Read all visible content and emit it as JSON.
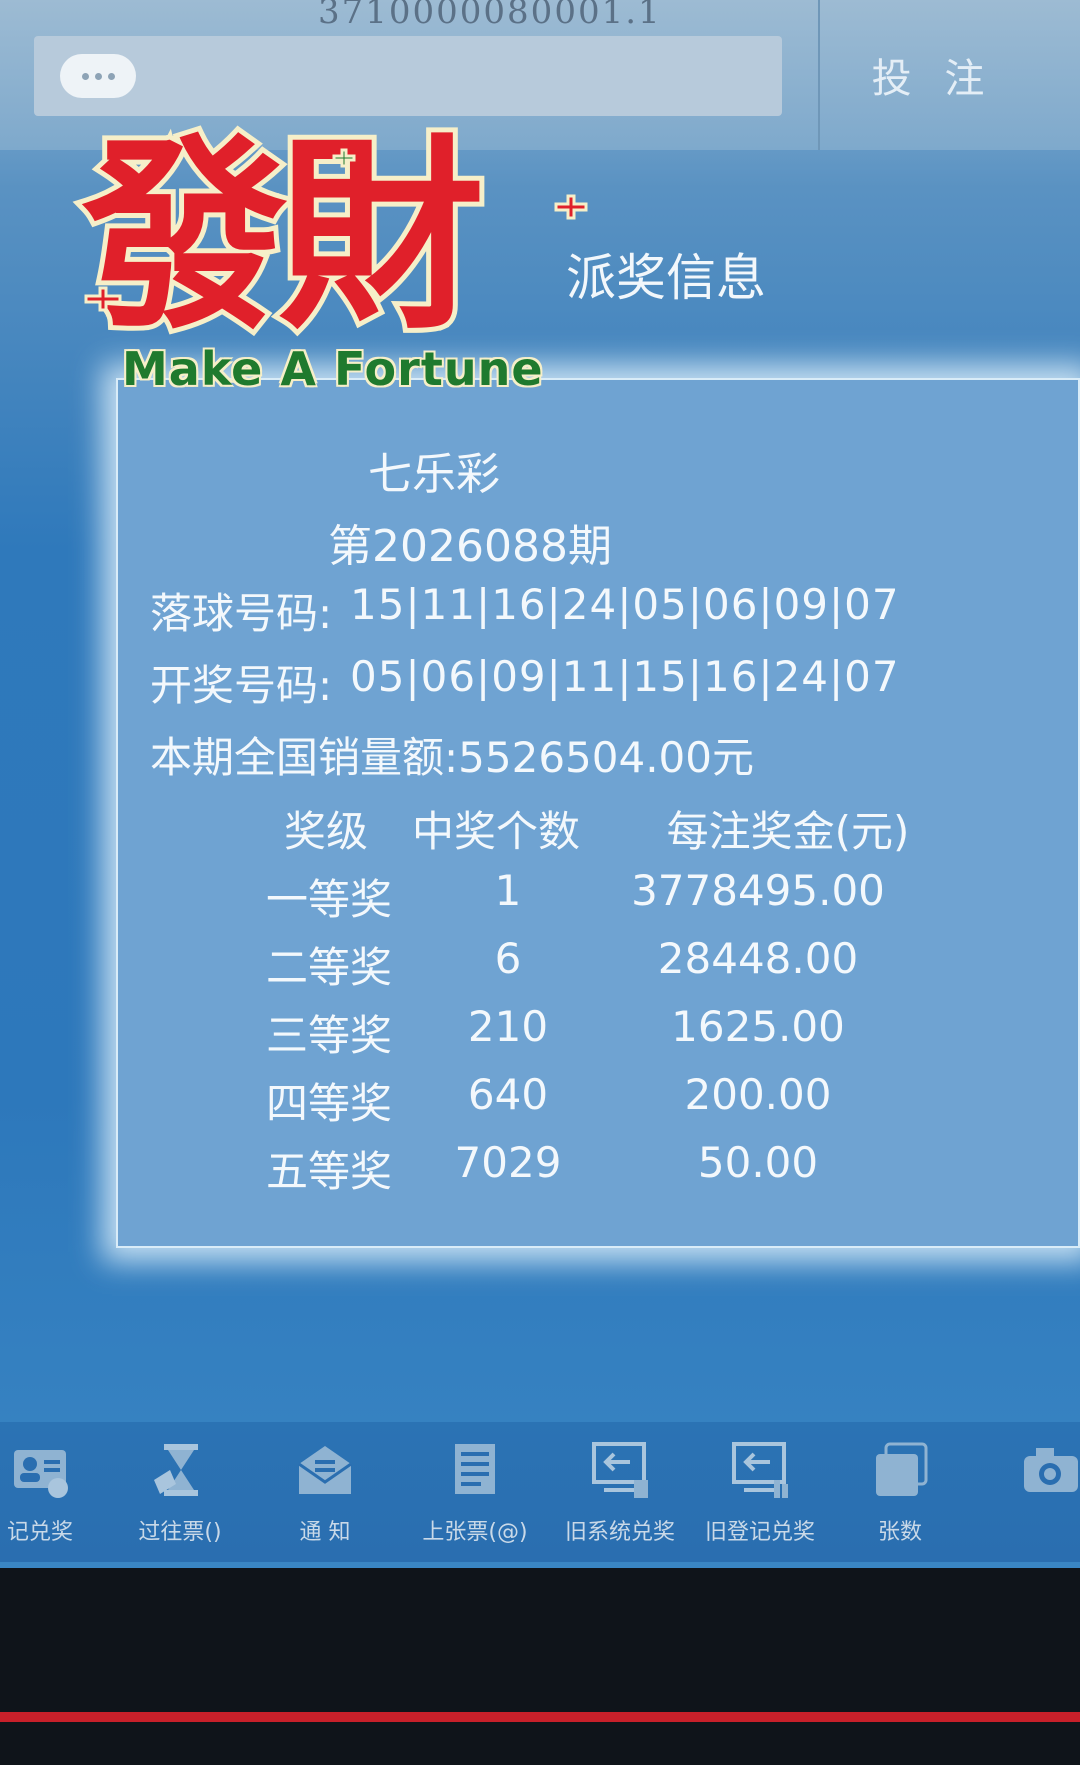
{
  "header": {
    "serial": "3710000080001.1",
    "bet_label": "投 注"
  },
  "page_title": "派奖信息",
  "sticker": {
    "chinese": "發財",
    "english": "Make A Fortune"
  },
  "draw": {
    "game": "七乐彩",
    "issue": "第2026088期",
    "drop_label": "落球号码:",
    "drop_numbers": "15|11|16|24|05|06|09|07",
    "draw_label": "开奖号码:",
    "draw_numbers": "05|06|09|11|15|16|24|07",
    "sales": "本期全国销量额:5526504.00元"
  },
  "prize_table": {
    "headers": {
      "level": "奖级",
      "count": "中奖个数",
      "amount": "每注奖金(元)"
    },
    "rows": [
      {
        "level": "一等奖",
        "count": "1",
        "amount": "3778495.00"
      },
      {
        "level": "二等奖",
        "count": "6",
        "amount": "28448.00"
      },
      {
        "level": "三等奖",
        "count": "210",
        "amount": "1625.00"
      },
      {
        "level": "四等奖",
        "count": "640",
        "amount": "200.00"
      },
      {
        "level": "五等奖",
        "count": "7029",
        "amount": "50.00"
      }
    ]
  },
  "toolbar": {
    "items": [
      {
        "label": "记兑奖",
        "icon": "id-card-icon"
      },
      {
        "label": "过往票()",
        "icon": "hourglass-icon"
      },
      {
        "label": "通 知",
        "icon": "envelope-icon"
      },
      {
        "label": "上张票(@)",
        "icon": "receipt-icon"
      },
      {
        "label": "旧系统兑奖",
        "icon": "exchange-screen-icon"
      },
      {
        "label": "旧登记兑奖",
        "icon": "register-screen-icon"
      },
      {
        "label": "张数",
        "icon": "stack-icon"
      },
      {
        "label": "",
        "icon": "camera-icon"
      }
    ]
  },
  "colors": {
    "screen_blue": "#2f79bb",
    "panel_blue": "#6fa3d2",
    "sticker_red": "#e0202a",
    "sticker_green": "#1f7a2e"
  }
}
